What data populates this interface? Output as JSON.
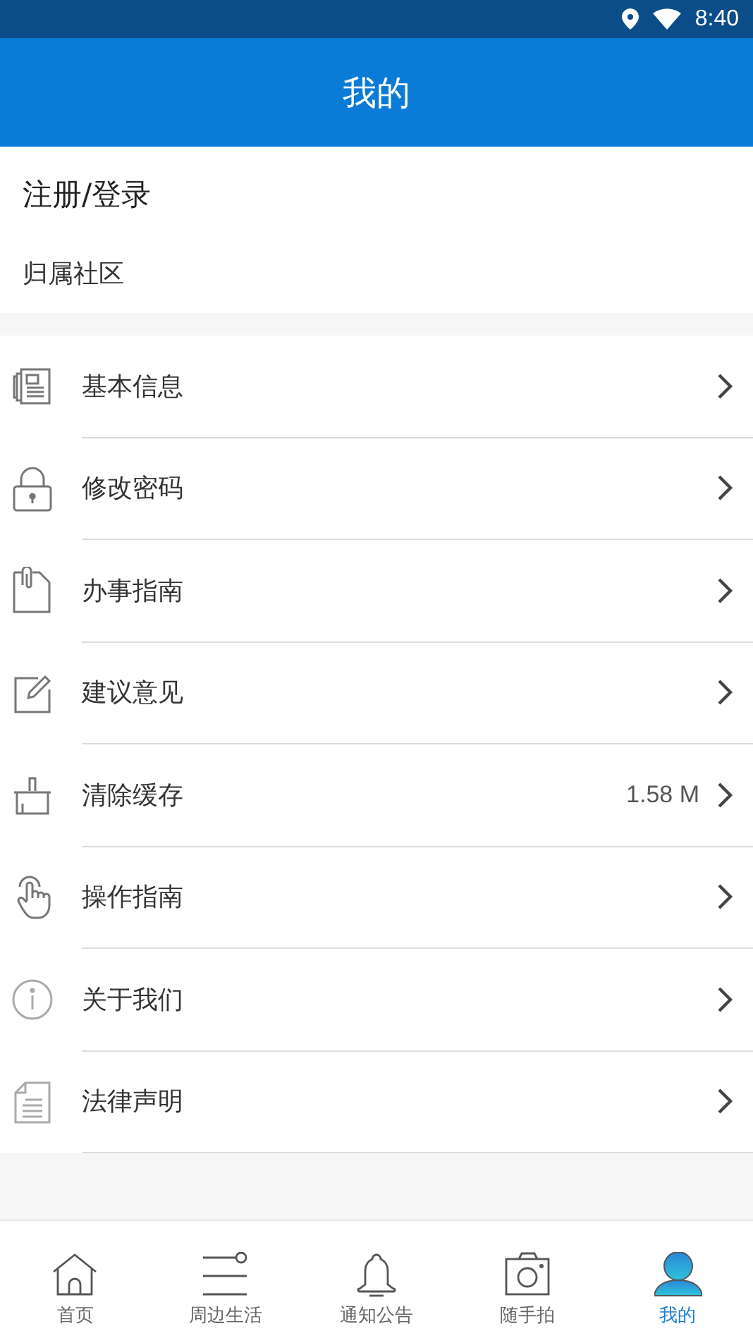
{
  "status_bar": {
    "time": "8:40"
  },
  "header": {
    "title": "我的"
  },
  "account": {
    "login": "注册/登录",
    "community": "归属社区"
  },
  "menu": [
    {
      "label": "基本信息"
    },
    {
      "label": "修改密码"
    },
    {
      "label": "办事指南"
    },
    {
      "label": "建议意见"
    },
    {
      "label": "清除缓存",
      "value": "1.58 M"
    },
    {
      "label": "操作指南"
    },
    {
      "label": "关于我们"
    },
    {
      "label": "法律声明"
    }
  ],
  "tabs": [
    {
      "label": "首页",
      "selected": false
    },
    {
      "label": "周边生活",
      "selected": false
    },
    {
      "label": "通知公告",
      "selected": false
    },
    {
      "label": "随手拍",
      "selected": false
    },
    {
      "label": "我的",
      "selected": true
    }
  ]
}
